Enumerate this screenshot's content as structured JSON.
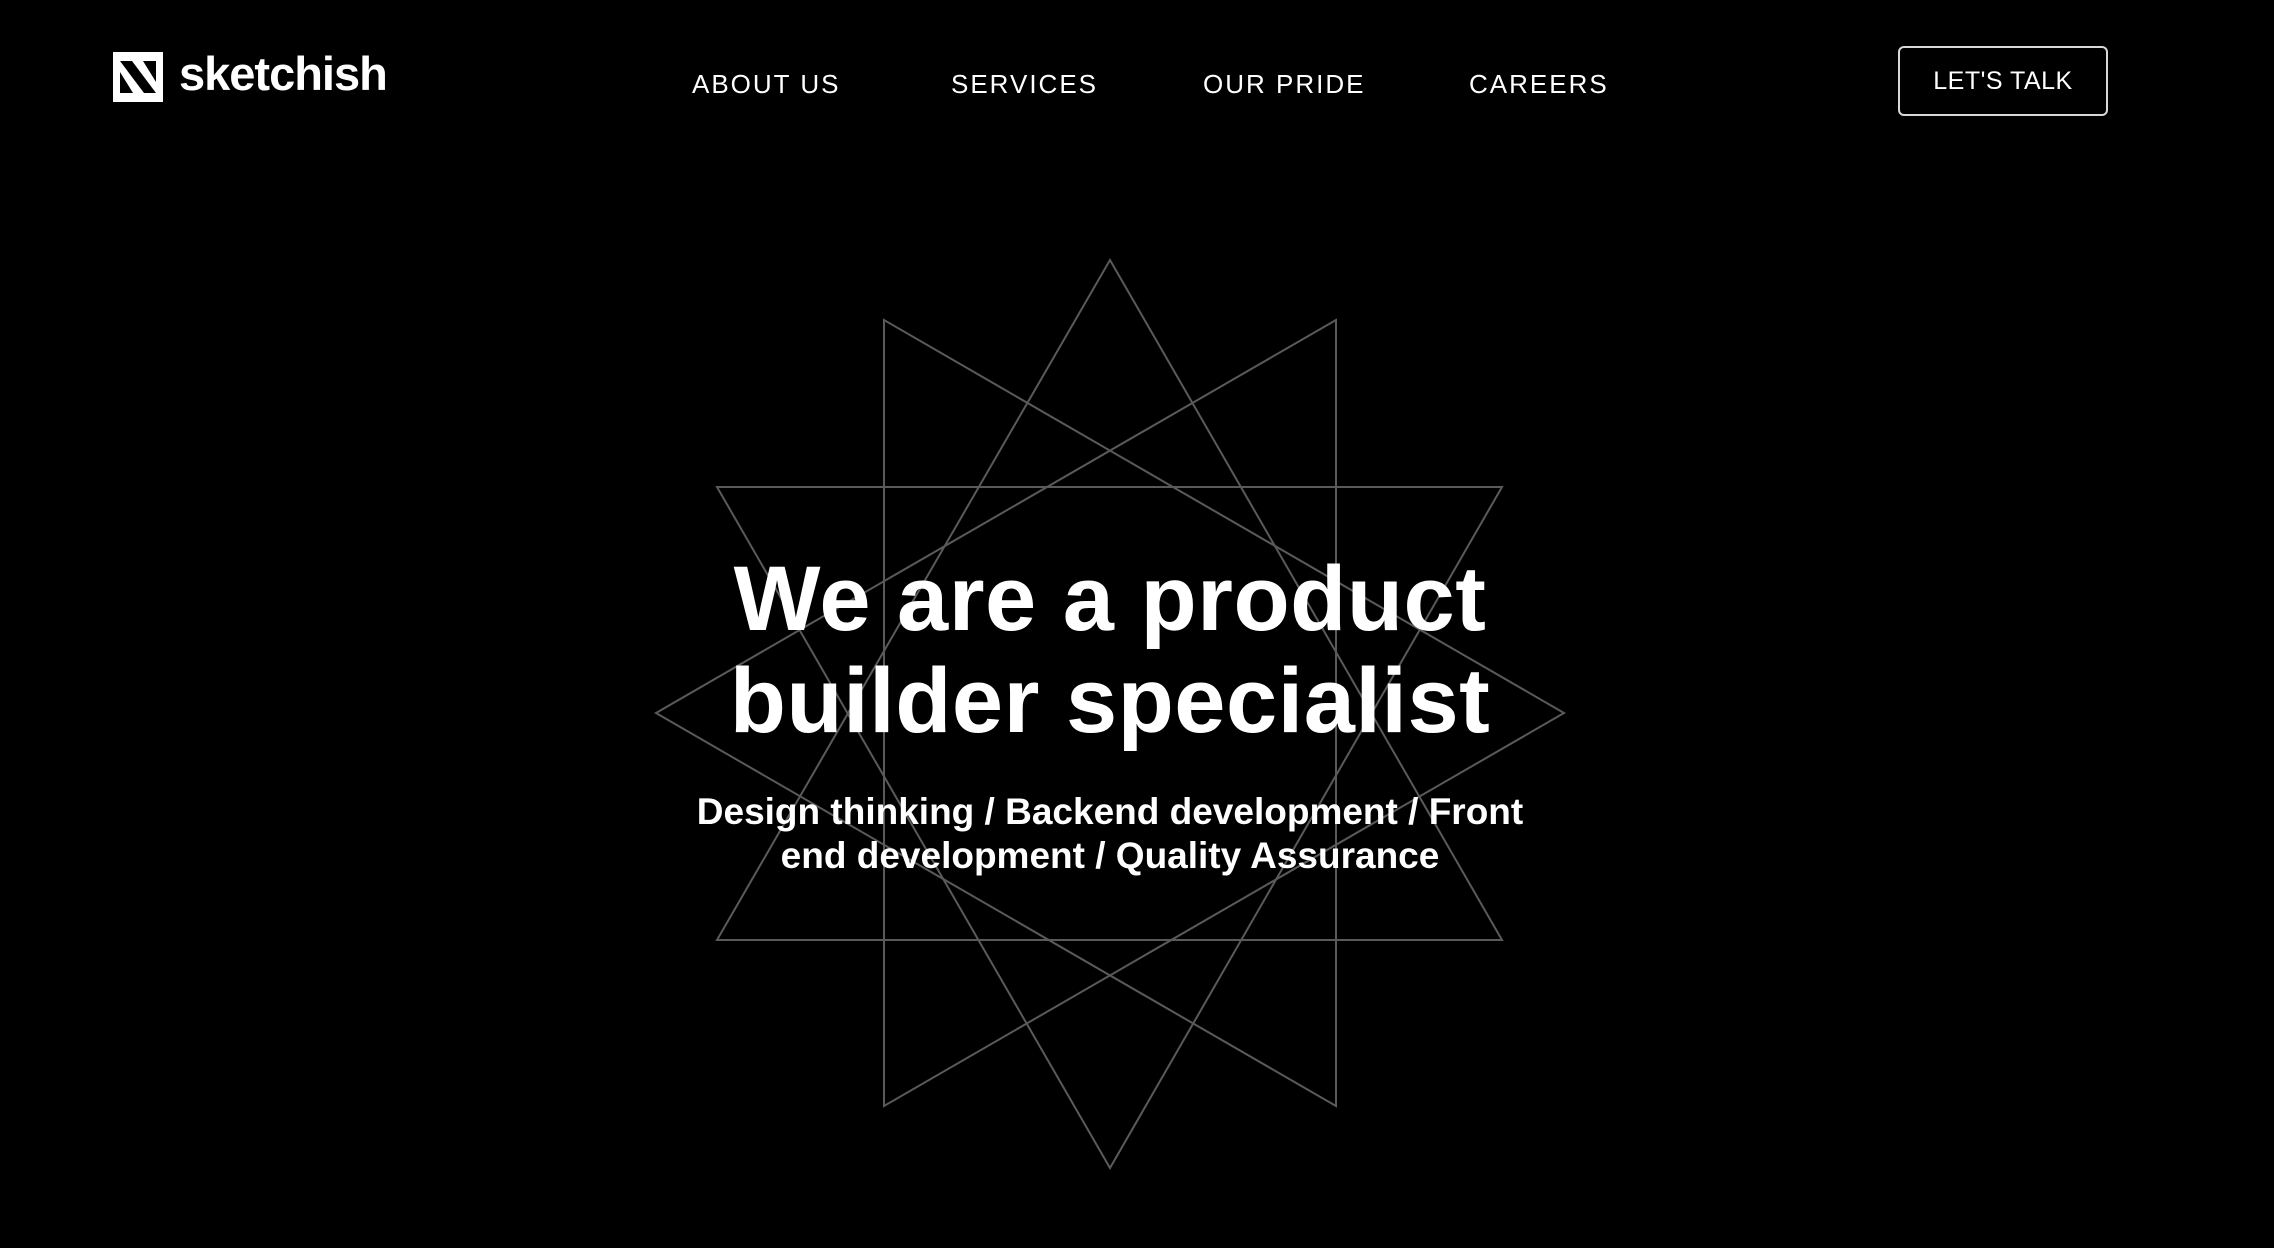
{
  "brand": {
    "name": "sketchish",
    "logo_icon": "sketchish-logo-icon"
  },
  "nav": {
    "items": [
      {
        "label": "ABOUT US"
      },
      {
        "label": "SERVICES"
      },
      {
        "label": "OUR PRIDE"
      },
      {
        "label": "CAREERS"
      }
    ]
  },
  "cta": {
    "label": "LET'S TALK"
  },
  "hero": {
    "title": "We are a product builder specialist",
    "subtitle": "Design thinking / Backend development / Front end development / Quality Assurance",
    "decoration_icon": "geometric-star-icon"
  },
  "colors": {
    "background": "#000000",
    "text": "#ffffff",
    "star_lines": "#5a5a5a",
    "button_border": "#d8d8d8"
  }
}
